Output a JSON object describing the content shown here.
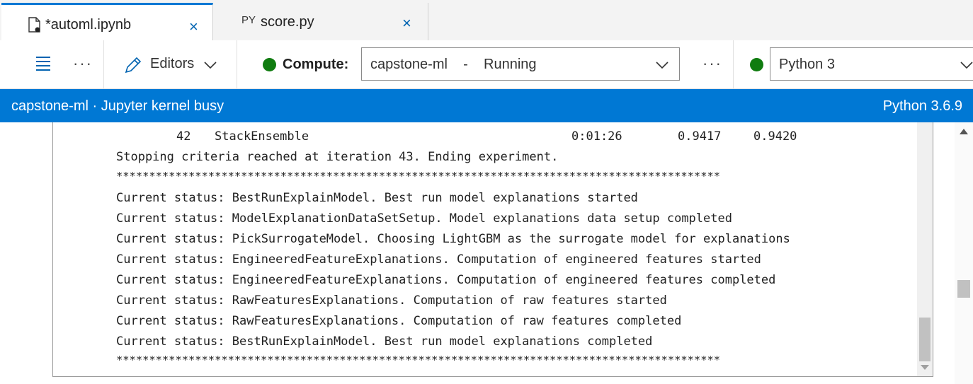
{
  "tabs": [
    {
      "label": "*automl.ipynb",
      "close": "×",
      "icon": "notebook-file-icon"
    },
    {
      "tag": "PY",
      "label": "score.py",
      "close": "×",
      "icon": "python-file-icon"
    }
  ],
  "toolbar": {
    "dots": "···",
    "editors_label": "Editors",
    "compute_label": "Compute:",
    "compute_value": "capstone-ml    -    Running",
    "kernel_value": "Python 3",
    "status_color": "#107c10"
  },
  "statusbar": {
    "left": "capstone-ml · Jupyter kernel busy",
    "right": "Python 3.6.9",
    "color": "#0078d4"
  },
  "output": {
    "row42": {
      "index": "42",
      "pipeline": "StackEnsemble",
      "duration": "0:01:26",
      "metric": "0.9417",
      "best": "0.9420"
    },
    "lines": [
      "Stopping criteria reached at iteration 43. Ending experiment.",
      "********************************************************************************************",
      "Current status: BestRunExplainModel. Best run model explanations started",
      "Current status: ModelExplanationDataSetSetup. Model explanations data setup completed",
      "Current status: PickSurrogateModel. Choosing LightGBM as the surrogate model for explanations",
      "Current status: EngineeredFeatureExplanations. Computation of engineered features started",
      "Current status: EngineeredFeatureExplanations. Computation of engineered features completed",
      "Current status: RawFeaturesExplanations. Computation of raw features started",
      "Current status: RawFeaturesExplanations. Computation of raw features completed",
      "Current status: BestRunExplainModel. Best run model explanations completed",
      "********************************************************************************************"
    ]
  }
}
